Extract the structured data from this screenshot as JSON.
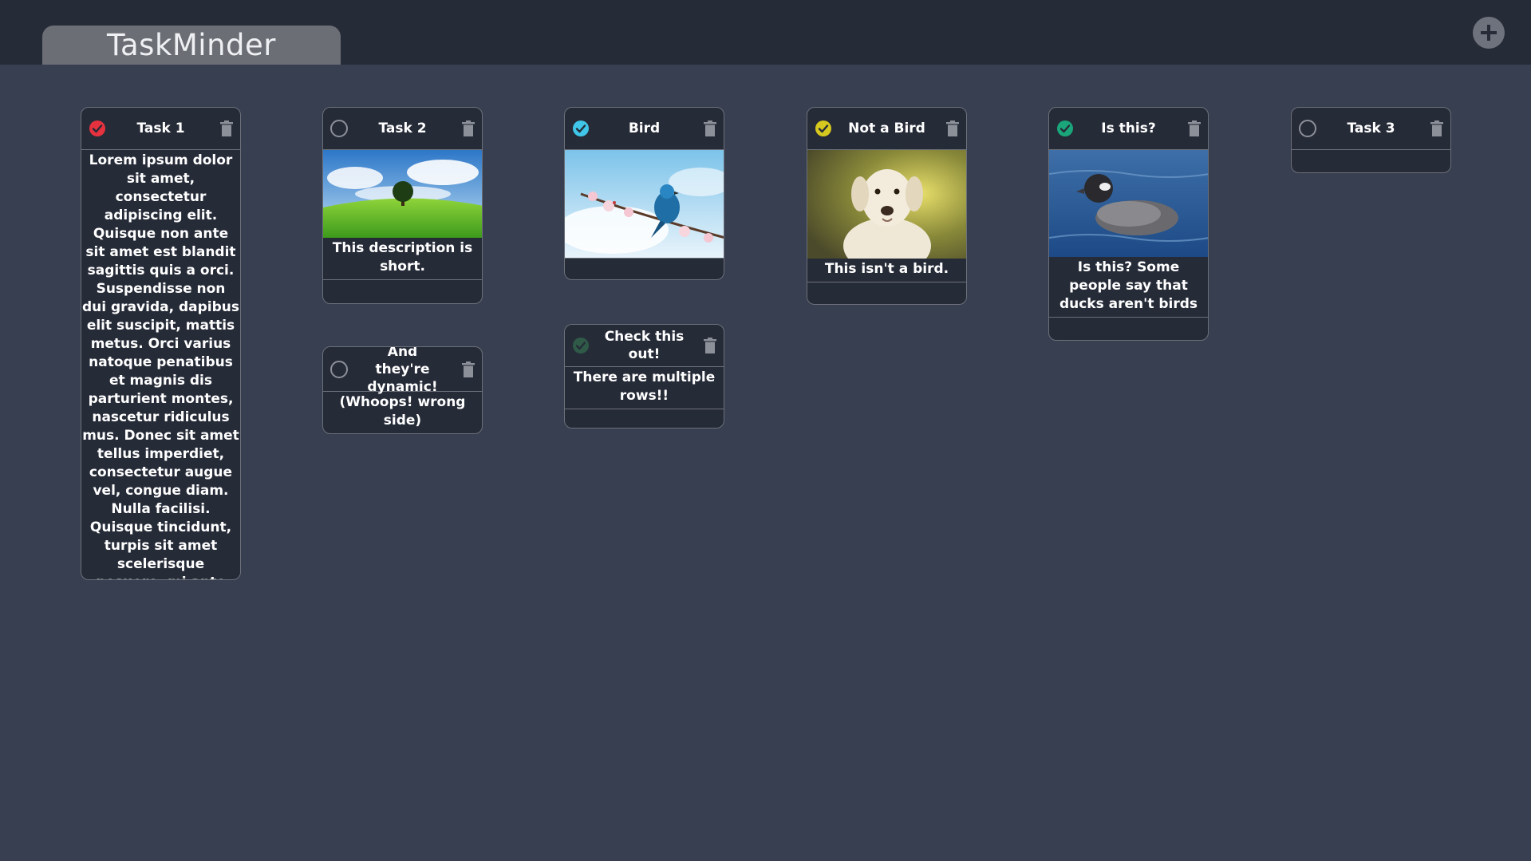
{
  "app": {
    "title": "TaskMinder"
  },
  "header": {
    "add_icon": "plus-circle-icon"
  },
  "colors": {
    "status_red": "#e5323e",
    "status_cyan": "#3fc6e8",
    "status_yellow": "#d6c81e",
    "status_green": "#1aa67a",
    "status_dark_green": "#2f5a48"
  },
  "cards": {
    "task1": {
      "title": "Task 1",
      "status": "checked-red",
      "description": "Lorem ipsum dolor sit amet, consectetur adipiscing elit. Quisque non ante sit amet est blandit sagittis quis a orci. Suspendisse non dui gravida, dapibus elit suscipit, mattis metus. Orci varius natoque penatibus et magnis dis parturient montes, nascetur ridiculus mus. Donec sit amet tellus imperdiet, consectetur augue vel, congue diam. Nulla facilisi. Quisque tincidunt, turpis sit amet scelerisque posuere, mi ante elementum ipsum, sed rutrum erat leo quis lorem."
    },
    "task2": {
      "title": "Task 2",
      "status": "unchecked",
      "image": "tree-on-green-hill",
      "description": "This description is short."
    },
    "dynamic": {
      "title": "And they're dynamic!",
      "status": "unchecked",
      "description": "(Whoops! wrong side)"
    },
    "bird": {
      "title": "Bird",
      "status": "checked-cyan",
      "image": "blue-bird-on-blossom-branch"
    },
    "check": {
      "title": "Check this out!",
      "status": "checked-dark-green",
      "description": "There are multiple rows!!"
    },
    "notbird": {
      "title": "Not a Bird",
      "status": "checked-yellow",
      "image": "white-labrador-dog",
      "description": "This isn't a bird."
    },
    "isthis": {
      "title": "Is this?",
      "status": "checked-green",
      "image": "duck-on-water",
      "description": "Is this? Some people say that ducks aren't birds"
    },
    "task3": {
      "title": "Task 3",
      "status": "unchecked"
    }
  }
}
